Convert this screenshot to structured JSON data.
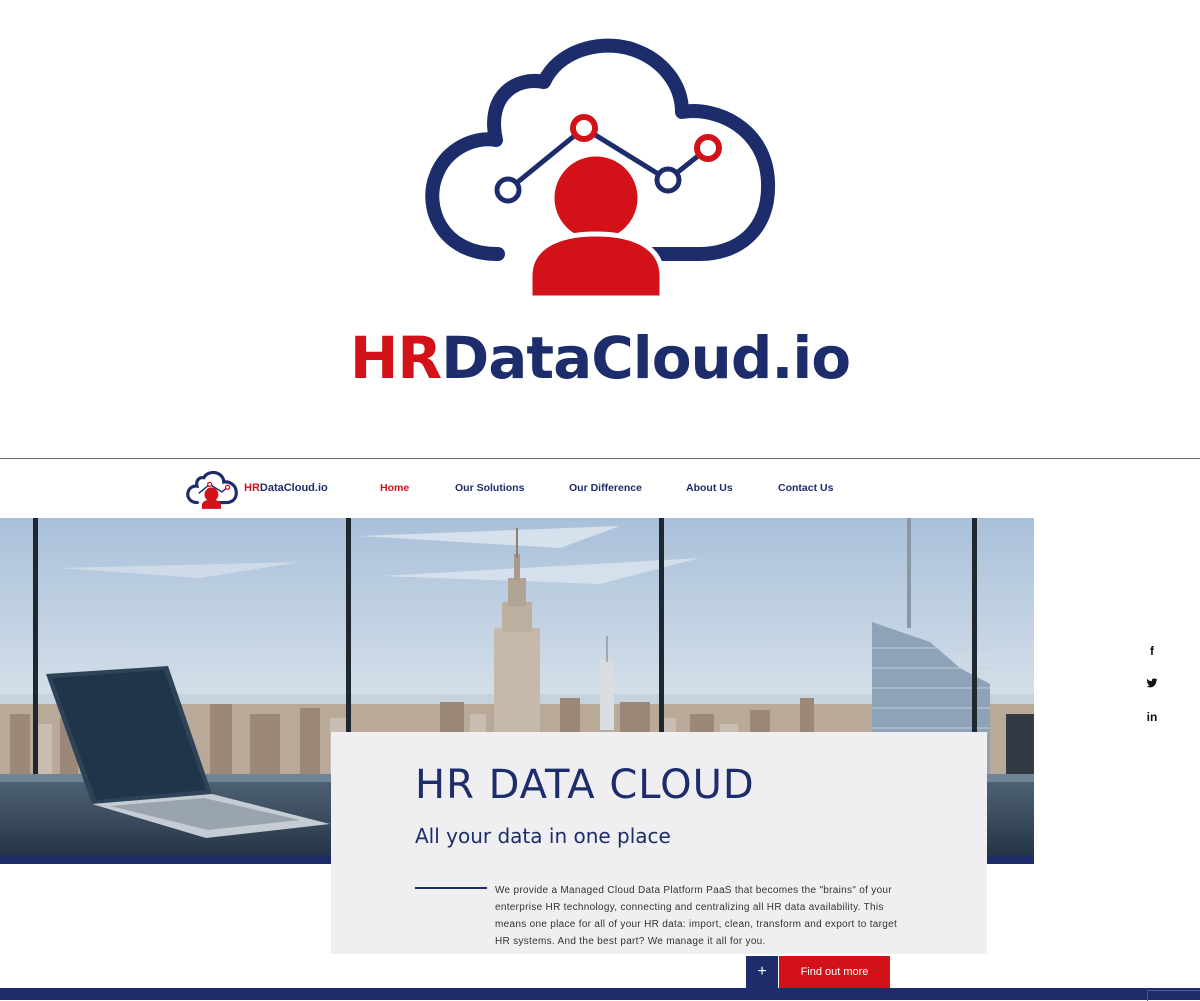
{
  "logo": {
    "wordmark_hr": "HR",
    "wordmark_rest": "DataCloud.io"
  },
  "colors": {
    "brand_red": "#d31118",
    "brand_navy": "#1d2d6b",
    "card_bg": "#efeff1"
  },
  "site": {
    "nav_logo_hr": "HR",
    "nav_logo_rest": "DataCloud.io",
    "menu": [
      {
        "label": "Home",
        "active": true
      },
      {
        "label": "Our Solutions",
        "active": false
      },
      {
        "label": "Our Difference",
        "active": false
      },
      {
        "label": "About Us",
        "active": false
      },
      {
        "label": "Contact Us",
        "active": false
      }
    ],
    "social": {
      "facebook": "f",
      "twitter": "t",
      "linkedin": "in"
    },
    "hero": {
      "title": "HR DATA CLOUD",
      "subtitle": "All your data in one place",
      "body": "We provide a Managed Cloud Data Platform PaaS that becomes the \"brains\" of your enterprise HR technology, connecting and centralizing all HR data availability. This means one place for all of your HR data: import, clean, transform and export to target HR systems. And the best part? We manage it all for you.",
      "plus_label": "+",
      "cta_label": "Find out more"
    }
  }
}
